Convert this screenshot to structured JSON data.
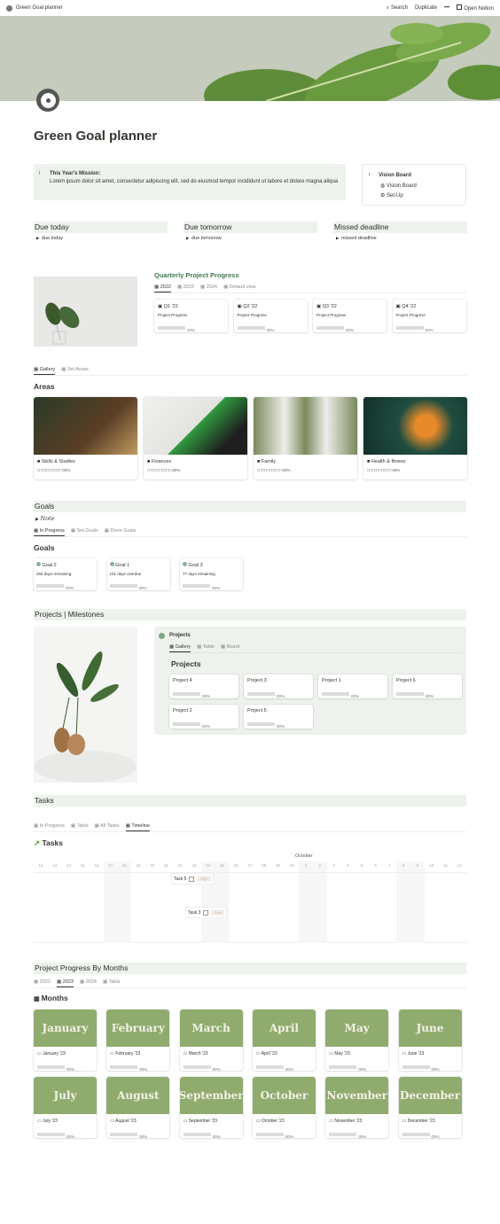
{
  "topbar": {
    "title": "Green Goal planner",
    "search": "Search",
    "duplicate": "Duplicate",
    "more": "•••",
    "open": "Open Notion"
  },
  "page": {
    "title": "Green Goal planner",
    "icon": "target-icon",
    "accent": "#8fac6e",
    "callout_bg": "#edf2ec"
  },
  "mission": {
    "title": "This Year's Mission:",
    "text": "Lorem ipsum dolor sit amet, consectetur adipiscing elit, sed do eiusmod tempor incididunt ut labore et dolore magna aliqua"
  },
  "vision": {
    "title": "Vision Board",
    "links": [
      "Vision Board",
      "Set-Up"
    ]
  },
  "due": [
    {
      "title": "Due today",
      "item": "due today"
    },
    {
      "title": "Due tomorrow",
      "item": "due tomorrow"
    },
    {
      "title": "Missed deadline",
      "item": "missed deadline"
    }
  ],
  "quarterly": {
    "title": "Quarterly Project Progress",
    "tabs": [
      "2022",
      "2023",
      "2024",
      "Default view"
    ],
    "cards": [
      {
        "name": "Q1 '22",
        "label": "Project Progress",
        "pct": "00%"
      },
      {
        "name": "Q2 '22",
        "label": "Project Progress",
        "pct": "00%"
      },
      {
        "name": "Q3 '22",
        "label": "Project Progress",
        "pct": "00%"
      },
      {
        "name": "Q4 '22",
        "label": "Project Progress",
        "pct": "00%"
      }
    ]
  },
  "areas": {
    "tabs": [
      "Gallery",
      "Set Areas"
    ],
    "title": "Areas",
    "cards": [
      {
        "name": "Skills & Studies",
        "progress": "□□□□□□□□□□ 00%"
      },
      {
        "name": "Finances",
        "progress": "□□□□□□□□□□ 00%"
      },
      {
        "name": "Family",
        "progress": "□□□□□□□□□□ 00%"
      },
      {
        "name": "Health & fitness",
        "progress": "□□□□□□□□□□ 00%"
      }
    ]
  },
  "goals": {
    "header": "Goals",
    "note": "Note",
    "tabs": [
      "In Progress",
      "Set Goals",
      "Done Goals"
    ],
    "title": "Goals",
    "cards": [
      {
        "name": "Goal 2",
        "status": "266 days remaining",
        "pct": "00%"
      },
      {
        "name": "Goal 1",
        "status": "101 days overdue",
        "pct": "00%"
      },
      {
        "name": "Goal 3",
        "status": "77 days remaining",
        "pct": "00%"
      }
    ]
  },
  "projects": {
    "header": "Projects | Milestones",
    "db": "Projects",
    "tabs": [
      "Gallery",
      "Table",
      "Board"
    ],
    "title": "Projects",
    "cards": [
      {
        "name": "Project 4",
        "pct": "00%"
      },
      {
        "name": "Project 3",
        "pct": "00%"
      },
      {
        "name": "Project 1",
        "pct": "00%"
      },
      {
        "name": "Project 6",
        "pct": "00%"
      },
      {
        "name": "Project 2",
        "pct": "00%"
      },
      {
        "name": "Project 5",
        "pct": "00%"
      }
    ]
  },
  "tasks": {
    "header": "Tasks",
    "tabs": [
      "In Progress",
      "Table",
      "All Tasks",
      "Timeline"
    ],
    "title": "Tasks",
    "month": "October",
    "days": [
      "12",
      "13",
      "14",
      "15",
      "16",
      "17",
      "18",
      "19",
      "20",
      "21",
      "22",
      "23",
      "24",
      "25",
      "26",
      "27",
      "28",
      "29",
      "30",
      "1",
      "2",
      "3",
      "4",
      "5",
      "6",
      "7",
      "8",
      "9",
      "10",
      "11",
      "12"
    ],
    "items": [
      {
        "name": "Task 5",
        "priority": "High"
      },
      {
        "name": "Task 3",
        "priority": "Low"
      }
    ]
  },
  "months": {
    "header": "Project Progress By Months",
    "tabs": [
      "2022",
      "2023",
      "2024",
      "Table"
    ],
    "title": "Months",
    "cards": [
      {
        "name": "January",
        "label": "January '23",
        "pct": "00%"
      },
      {
        "name": "February",
        "label": "February '23",
        "pct": "00%"
      },
      {
        "name": "March",
        "label": "March '23",
        "pct": "00%"
      },
      {
        "name": "April",
        "label": "April '23",
        "pct": "00%"
      },
      {
        "name": "May",
        "label": "May '23",
        "pct": "00%"
      },
      {
        "name": "June",
        "label": "June '23",
        "pct": "00%"
      },
      {
        "name": "July",
        "label": "July '23",
        "pct": "00%"
      },
      {
        "name": "August",
        "label": "August '23",
        "pct": "00%"
      },
      {
        "name": "September",
        "label": "September '23",
        "pct": "00%"
      },
      {
        "name": "October",
        "label": "October '23",
        "pct": "00%"
      },
      {
        "name": "November",
        "label": "November '23",
        "pct": "00%"
      },
      {
        "name": "December",
        "label": "December '23",
        "pct": "00%"
      }
    ]
  }
}
